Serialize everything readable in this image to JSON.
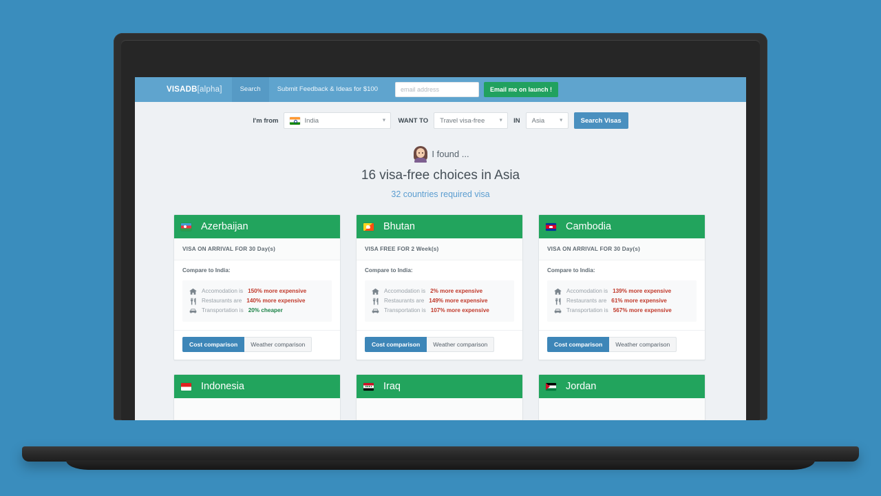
{
  "navbar": {
    "brand": "VISADB",
    "brand_tag": "[alpha]",
    "links": [
      {
        "label": "Search",
        "active": true
      },
      {
        "label": "Submit Feedback & Ideas for $100",
        "active": false
      }
    ],
    "email_placeholder": "email address",
    "email_value": "",
    "launch_button": "Email me on launch !",
    "bg_color": "#5fa4ce",
    "launch_button_color": "#21a15f"
  },
  "search": {
    "from_label": "I'm from",
    "from_value": "India",
    "from_flag": "flag-india",
    "want_label": "WANT TO",
    "want_value": "Travel visa-free",
    "in_label": "IN",
    "in_value": "Asia",
    "submit_label": "Search Visas",
    "submit_color": "#4a90bf"
  },
  "results": {
    "found_text": "I found ...",
    "avatar": "woman-avatar",
    "title": "16 visa-free choices in Asia",
    "subtitle": "32 countries required visa",
    "subtitle_color": "#5b9dd0"
  },
  "card_labels": {
    "compare_to": "Compare to India:",
    "accommodation": "Accomodation is",
    "restaurants": "Restaurants are",
    "transportation": "Transportation is",
    "cost_button": "Cost comparison",
    "weather_button": "Weather comparison",
    "header_color": "#22a45d",
    "cost_button_color": "#3d86b8",
    "up_color": "#c0392b",
    "down_color": "#1d8348"
  },
  "cards": [
    {
      "country": "Azerbaijan",
      "flag": "flag-az",
      "visa": "VISA ON ARRIVAL FOR 30 Day(s)",
      "accommodation": "150% more expensive",
      "accommodation_dir": "up",
      "restaurants": "140% more expensive",
      "restaurants_dir": "up",
      "transportation": "20% cheaper",
      "transportation_dir": "down"
    },
    {
      "country": "Bhutan",
      "flag": "flag-bt",
      "visa": "VISA FREE FOR 2 Week(s)",
      "accommodation": "2% more expensive",
      "accommodation_dir": "up",
      "restaurants": "149% more expensive",
      "restaurants_dir": "up",
      "transportation": "107% more expensive",
      "transportation_dir": "up"
    },
    {
      "country": "Cambodia",
      "flag": "flag-kh",
      "visa": "VISA ON ARRIVAL FOR 30 Day(s)",
      "accommodation": "139% more expensive",
      "accommodation_dir": "up",
      "restaurants": "61% more expensive",
      "restaurants_dir": "up",
      "transportation": "567% more expensive",
      "transportation_dir": "up"
    },
    {
      "country": "Indonesia",
      "flag": "flag-id"
    },
    {
      "country": "Iraq",
      "flag": "flag-iq"
    },
    {
      "country": "Jordan",
      "flag": "flag-jo"
    }
  ],
  "background_color": "#3a8dbd"
}
